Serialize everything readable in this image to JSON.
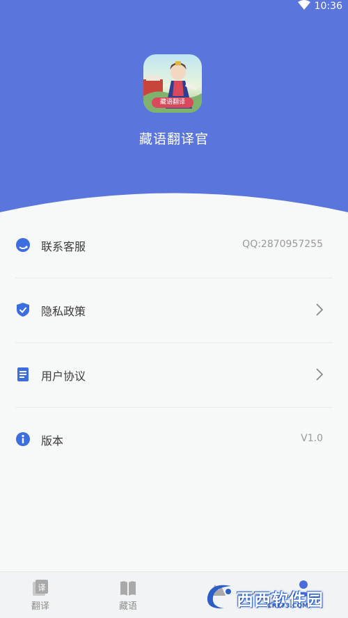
{
  "status_bar": {
    "time": "10:36"
  },
  "app": {
    "name": "藏语翻译官",
    "icon_badge": "藏语翻译"
  },
  "menu": [
    {
      "label": "联系客服",
      "value": "QQ:2870957255",
      "icon": "headset-icon"
    },
    {
      "label": "隐私政策",
      "value": "",
      "icon": "shield-check-icon",
      "chevron": true
    },
    {
      "label": "用户协议",
      "value": "",
      "icon": "document-icon",
      "chevron": true
    },
    {
      "label": "版本",
      "value": "V1.0",
      "icon": "info-icon"
    }
  ],
  "tabs": [
    {
      "label": "翻译",
      "icon": "translate-icon"
    },
    {
      "label": "藏语",
      "icon": "book-icon"
    },
    {
      "label": "",
      "icon": "mountain-icon"
    },
    {
      "label": "",
      "icon": "user-icon",
      "active": true
    }
  ],
  "watermark": {
    "text": "西西软件园",
    "url": "CR173.COM"
  },
  "colors": {
    "primary": "#5a76dc",
    "accent": "#4a6bdc",
    "icon_blue": "#3d6ee0"
  }
}
